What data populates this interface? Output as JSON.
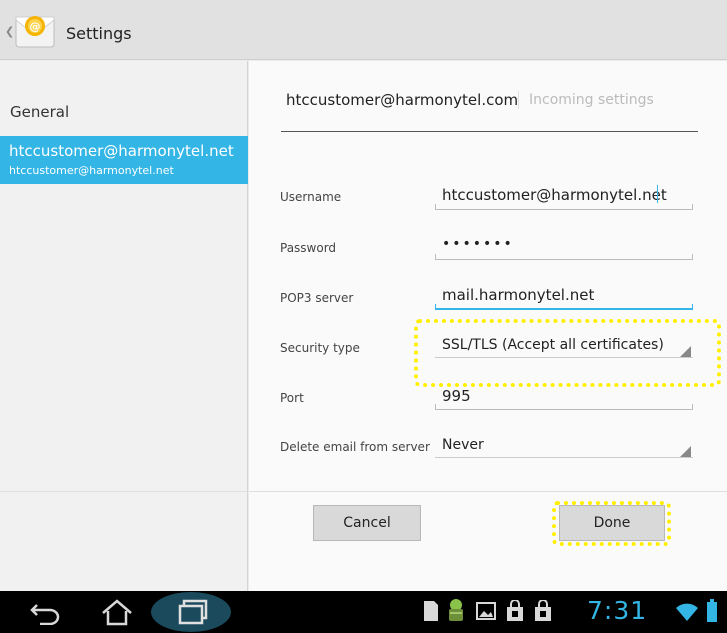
{
  "action_bar": {
    "title": "Settings",
    "app_icon": "email-icon",
    "up_icon": "chevron-left-icon"
  },
  "left_list": {
    "general_label": "General",
    "account": {
      "title": "htccustomer@harmonytel.net",
      "subtitle": "htccustomer@harmonytel.net"
    }
  },
  "header": {
    "account": "htccustomer@harmonytel.com",
    "section": "Incoming settings"
  },
  "form": {
    "username_label": "Username",
    "username_value": "htccustomer@harmonytel.net",
    "password_label": "Password",
    "password_value": "•••••••",
    "pop3_label": "POP3 server",
    "pop3_value": "mail.harmonytel.net",
    "security_label": "Security type",
    "security_value": "SSL/TLS (Accept all certificates)",
    "port_label": "Port",
    "port_value": "995",
    "delete_label": "Delete email from server",
    "delete_value": "Never"
  },
  "buttons": {
    "cancel": "Cancel",
    "done": "Done"
  },
  "system_bar": {
    "time": "7:31",
    "nav_icons": [
      "back-icon",
      "home-icon",
      "recent-apps-icon"
    ],
    "status_icons": [
      "sd-card-icon",
      "android-icon",
      "image-icon",
      "shopping-bag-icon",
      "shopping-bag-icon",
      "wifi-icon",
      "battery-icon"
    ]
  },
  "colors": {
    "accent": "#33b5e5",
    "highlight": "#ffef00"
  }
}
